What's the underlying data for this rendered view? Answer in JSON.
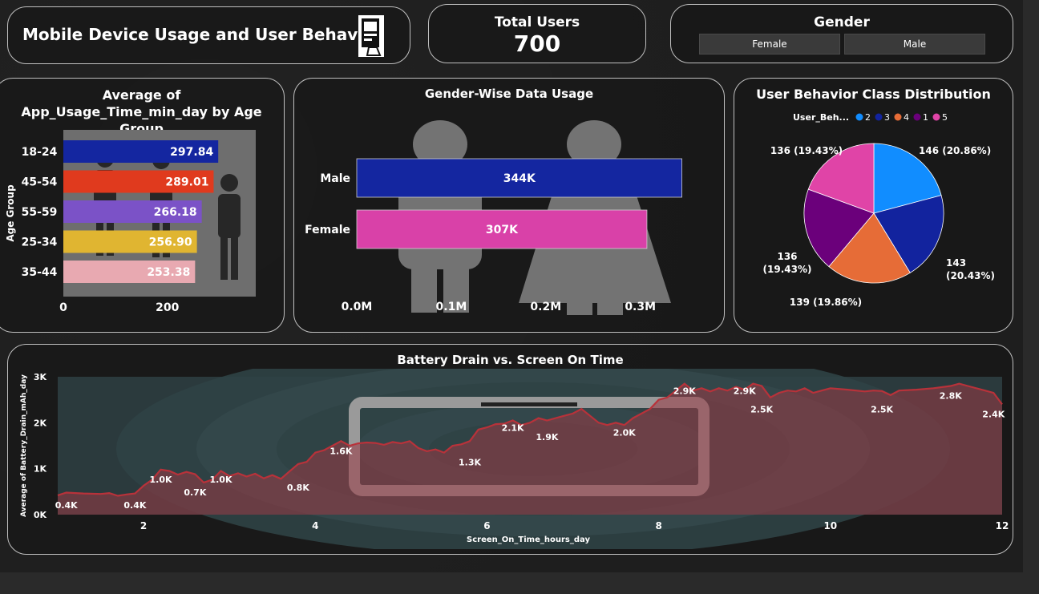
{
  "header": {
    "title": "Mobile Device Usage and User Behavior",
    "icon": "phone-hand-icon"
  },
  "kpi": {
    "label": "Total Users",
    "value": "700"
  },
  "gender_slicer": {
    "title": "Gender",
    "options": [
      "Female",
      "Male"
    ]
  },
  "colors": {
    "navy": "#1426a0",
    "red": "#e03a1e",
    "purple": "#7b52c7",
    "yellow": "#e0b531",
    "pink_light": "#e8a9b1",
    "magenta": "#d941a8",
    "pie_blue": "#118dff",
    "pie_navy": "#12239e",
    "pie_orange": "#e66c37",
    "pie_purple": "#6b007b",
    "pie_pink": "#e044a7",
    "line": "#b8323a"
  },
  "chart_data": [
    {
      "type": "bar",
      "orientation": "horizontal",
      "title": "Average of App_Usage_Time_min_day by Age Group",
      "ylabel": "Age Group",
      "xlabel": "",
      "categories": [
        "18-24",
        "45-54",
        "55-59",
        "25-34",
        "35-44"
      ],
      "values": [
        297.84,
        289.01,
        266.18,
        256.9,
        253.38
      ],
      "data_labels": [
        "297.84",
        "289.01",
        "266.18",
        "256.90",
        "253.38"
      ],
      "xticks": [
        "0",
        "200"
      ],
      "xlim": [
        0,
        370
      ],
      "bar_colors": [
        "#1426a0",
        "#e03a1e",
        "#7b52c7",
        "#e0b531",
        "#e8a9b1"
      ]
    },
    {
      "type": "bar",
      "orientation": "horizontal",
      "title": "Gender-Wise Data Usage",
      "categories": [
        "Male",
        "Female"
      ],
      "values": [
        344000,
        307000
      ],
      "data_labels": [
        "344K",
        "307K"
      ],
      "xticks": [
        "0.0M",
        "0.1M",
        "0.2M",
        "0.3M"
      ],
      "xlim": [
        0,
        0.38
      ],
      "bar_colors": [
        "#1426a0",
        "#d941a8"
      ]
    },
    {
      "type": "pie",
      "title": "User Behavior Class Distribution",
      "legend_title": "User_Beh...",
      "legend_position": "top",
      "series": [
        {
          "name": "2",
          "value": 146,
          "label_value": "146",
          "label_pct": "(20.86%)",
          "color": "#118dff"
        },
        {
          "name": "3",
          "value": 143,
          "label_value": "143",
          "label_pct": "(20.43%)",
          "color": "#12239e"
        },
        {
          "name": "4",
          "value": 139,
          "label_value": "139",
          "label_pct": "(19.86%)",
          "color": "#e66c37"
        },
        {
          "name": "1",
          "value": 136,
          "label_value": "136",
          "label_pct": "(19.43%)",
          "color": "#6b007b"
        },
        {
          "name": "5",
          "value": 136,
          "label_value": "136",
          "label_pct": "(19.43%)",
          "color": "#e044a7"
        }
      ]
    },
    {
      "type": "area",
      "title": "Battery Drain vs. Screen On Time",
      "xlabel": "Screen_On_Time_hours_day",
      "ylabel": "Average of Battery_Drain_mAh_day",
      "xlim": [
        1,
        12
      ],
      "ylim": [
        0,
        3000
      ],
      "xticks": [
        "2",
        "4",
        "6",
        "8",
        "10",
        "12"
      ],
      "yticks": [
        "0K",
        "1K",
        "2K",
        "3K"
      ],
      "points": [
        [
          1.0,
          420
        ],
        [
          1.1,
          480
        ],
        [
          1.3,
          460
        ],
        [
          1.5,
          450
        ],
        [
          1.6,
          470
        ],
        [
          1.7,
          410
        ],
        [
          1.8,
          440
        ],
        [
          1.9,
          460
        ],
        [
          2.0,
          630
        ],
        [
          2.1,
          760
        ],
        [
          2.2,
          980
        ],
        [
          2.3,
          950
        ],
        [
          2.4,
          870
        ],
        [
          2.5,
          930
        ],
        [
          2.6,
          880
        ],
        [
          2.7,
          700
        ],
        [
          2.8,
          760
        ],
        [
          2.9,
          950
        ],
        [
          3.0,
          840
        ],
        [
          3.1,
          900
        ],
        [
          3.2,
          830
        ],
        [
          3.3,
          890
        ],
        [
          3.4,
          790
        ],
        [
          3.5,
          860
        ],
        [
          3.6,
          780
        ],
        [
          3.7,
          940
        ],
        [
          3.8,
          1100
        ],
        [
          3.9,
          1150
        ],
        [
          4.0,
          1350
        ],
        [
          4.1,
          1400
        ],
        [
          4.2,
          1500
        ],
        [
          4.3,
          1600
        ],
        [
          4.4,
          1500
        ],
        [
          4.5,
          1550
        ],
        [
          4.6,
          1570
        ],
        [
          4.7,
          1560
        ],
        [
          4.8,
          1520
        ],
        [
          4.9,
          1580
        ],
        [
          5.0,
          1550
        ],
        [
          5.1,
          1600
        ],
        [
          5.2,
          1450
        ],
        [
          5.3,
          1380
        ],
        [
          5.4,
          1420
        ],
        [
          5.5,
          1350
        ],
        [
          5.6,
          1500
        ],
        [
          5.7,
          1530
        ],
        [
          5.8,
          1600
        ],
        [
          5.9,
          1850
        ],
        [
          6.0,
          1900
        ],
        [
          6.1,
          1970
        ],
        [
          6.2,
          1980
        ],
        [
          6.3,
          2050
        ],
        [
          6.4,
          1950
        ],
        [
          6.5,
          2000
        ],
        [
          6.6,
          2100
        ],
        [
          6.7,
          2050
        ],
        [
          6.8,
          2100
        ],
        [
          6.9,
          2150
        ],
        [
          7.0,
          2200
        ],
        [
          7.1,
          2300
        ],
        [
          7.2,
          2150
        ],
        [
          7.3,
          2000
        ],
        [
          7.4,
          1950
        ],
        [
          7.5,
          2000
        ],
        [
          7.6,
          1950
        ],
        [
          7.7,
          2100
        ],
        [
          7.8,
          2200
        ],
        [
          7.9,
          2300
        ],
        [
          8.0,
          2500
        ],
        [
          8.1,
          2550
        ],
        [
          8.2,
          2700
        ],
        [
          8.3,
          2850
        ],
        [
          8.4,
          2700
        ],
        [
          8.5,
          2750
        ],
        [
          8.6,
          2680
        ],
        [
          8.7,
          2750
        ],
        [
          8.8,
          2700
        ],
        [
          8.9,
          2780
        ],
        [
          9.0,
          2720
        ],
        [
          9.1,
          2850
        ],
        [
          9.2,
          2800
        ],
        [
          9.3,
          2550
        ],
        [
          9.4,
          2650
        ],
        [
          9.5,
          2700
        ],
        [
          9.6,
          2680
        ],
        [
          9.7,
          2750
        ],
        [
          9.8,
          2650
        ],
        [
          9.9,
          2700
        ],
        [
          10.0,
          2750
        ],
        [
          10.2,
          2720
        ],
        [
          10.4,
          2680
        ],
        [
          10.5,
          2700
        ],
        [
          10.6,
          2690
        ],
        [
          10.7,
          2600
        ],
        [
          10.8,
          2700
        ],
        [
          11.0,
          2720
        ],
        [
          11.2,
          2750
        ],
        [
          11.4,
          2800
        ],
        [
          11.5,
          2850
        ],
        [
          11.6,
          2800
        ],
        [
          11.8,
          2700
        ],
        [
          11.9,
          2650
        ],
        [
          12.0,
          2400
        ]
      ],
      "data_labels": [
        {
          "x": 1.1,
          "y": 420,
          "text": "0.4K"
        },
        {
          "x": 1.9,
          "y": 420,
          "text": "0.4K"
        },
        {
          "x": 2.2,
          "y": 980,
          "text": "1.0K"
        },
        {
          "x": 2.6,
          "y": 700,
          "text": "0.7K"
        },
        {
          "x": 2.9,
          "y": 980,
          "text": "1.0K"
        },
        {
          "x": 3.8,
          "y": 800,
          "text": "0.8K"
        },
        {
          "x": 4.3,
          "y": 1600,
          "text": "1.6K"
        },
        {
          "x": 5.8,
          "y": 1350,
          "text": "1.3K"
        },
        {
          "x": 6.3,
          "y": 2100,
          "text": "2.1K"
        },
        {
          "x": 6.7,
          "y": 1900,
          "text": "1.9K"
        },
        {
          "x": 7.6,
          "y": 2000,
          "text": "2.0K"
        },
        {
          "x": 8.3,
          "y": 2900,
          "text": "2.9K"
        },
        {
          "x": 9.0,
          "y": 2900,
          "text": "2.9K"
        },
        {
          "x": 9.2,
          "y": 2500,
          "text": "2.5K"
        },
        {
          "x": 10.6,
          "y": 2500,
          "text": "2.5K"
        },
        {
          "x": 11.4,
          "y": 2800,
          "text": "2.8K"
        },
        {
          "x": 11.9,
          "y": 2400,
          "text": "2.4K"
        }
      ]
    }
  ]
}
